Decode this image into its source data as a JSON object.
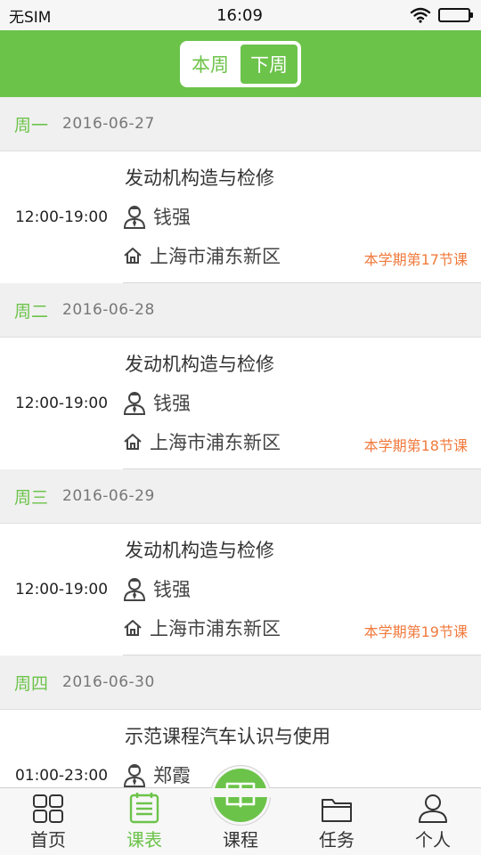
{
  "status_bar": {
    "carrier": "无SIM",
    "time": "16:09",
    "battery_level": 1.0
  },
  "week_toggle": {
    "options": [
      "本周",
      "下周"
    ],
    "selected": "下周"
  },
  "days": [
    {
      "weekday": "周一",
      "date": "2016-06-27",
      "course": {
        "time": "12:00-19:00",
        "title": "发动机构造与检修",
        "teacher": "钱强",
        "location": "上海市浦东新区",
        "lesson": "本学期第17节课"
      }
    },
    {
      "weekday": "周二",
      "date": "2016-06-28",
      "course": {
        "time": "12:00-19:00",
        "title": "发动机构造与检修",
        "teacher": "钱强",
        "location": "上海市浦东新区",
        "lesson": "本学期第18节课"
      }
    },
    {
      "weekday": "周三",
      "date": "2016-06-29",
      "course": {
        "time": "12:00-19:00",
        "title": "发动机构造与检修",
        "teacher": "钱强",
        "location": "上海市浦东新区",
        "lesson": "本学期第19节课"
      }
    },
    {
      "weekday": "周四",
      "date": "2016-06-30",
      "course": {
        "time": "01:00-23:00",
        "title": "示范课程汽车认识与使用",
        "teacher": "郑霞",
        "location": "",
        "lesson": ""
      }
    }
  ],
  "tabs": [
    {
      "label": "首页",
      "icon": "grid-icon",
      "active": false
    },
    {
      "label": "课表",
      "icon": "schedule-icon",
      "active": true
    },
    {
      "label": "课程",
      "icon": "book-icon",
      "active": false
    },
    {
      "label": "任务",
      "icon": "folder-icon",
      "active": false
    },
    {
      "label": "个人",
      "icon": "person-icon",
      "active": false
    }
  ],
  "colors": {
    "brand_green": "#6cc34a",
    "lesson_orange": "#f07a3d",
    "day_header_bg": "#f0f0f0"
  }
}
